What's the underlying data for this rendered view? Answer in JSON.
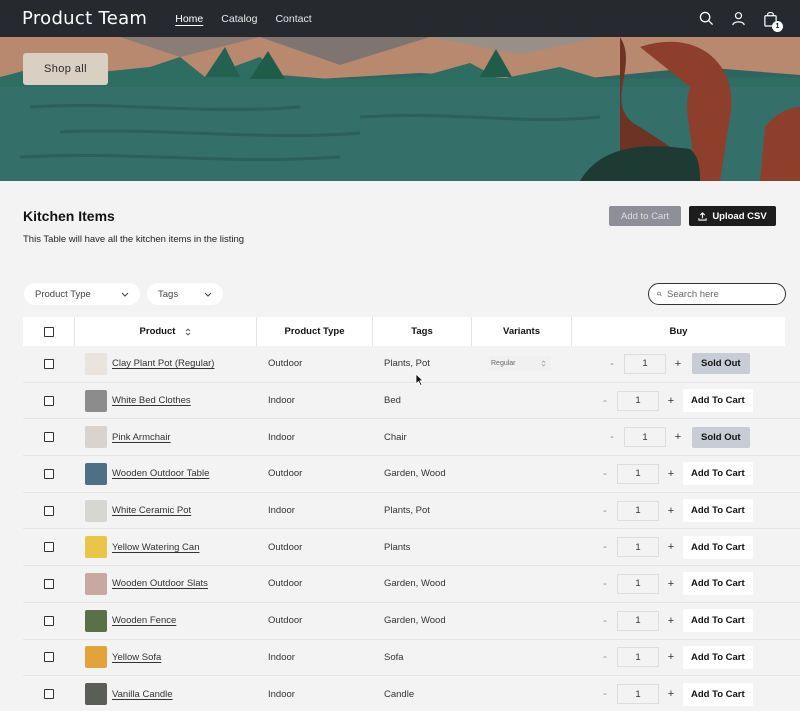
{
  "header": {
    "brand": "Product Team",
    "nav": [
      {
        "label": "Home",
        "active": true
      },
      {
        "label": "Catalog",
        "active": false
      },
      {
        "label": "Contact",
        "active": false
      }
    ],
    "icons": [
      "search-icon",
      "account-icon",
      "bag-icon"
    ],
    "cart_count": "1"
  },
  "hero": {
    "button_label": "Shop all"
  },
  "section": {
    "title": "Kitchen Items",
    "description": "This Table will have all the kitchen items in the listing",
    "add_to_cart_label": "Add to Cart",
    "upload_label": "Upload CSV"
  },
  "filters": {
    "product_type_label": "Product Type",
    "tags_label": "Tags",
    "search_placeholder": "Search here"
  },
  "table": {
    "columns": [
      "Product",
      "Product Type",
      "Tags",
      "Variants",
      "Buy"
    ],
    "rows": [
      {
        "name": "Clay Plant Pot (Regular)",
        "type": "Outdoor",
        "tags": "Plants, Pot",
        "variant": "Regular",
        "qty": "1",
        "action": "Sold Out",
        "sold_out": true,
        "thumb_color": "#e9e4de"
      },
      {
        "name": "White Bed Clothes",
        "type": "Indoor",
        "tags": "Bed",
        "variant": "",
        "qty": "1",
        "action": "Add To Cart",
        "sold_out": false,
        "thumb_color": "#8c8c8c"
      },
      {
        "name": "Pink Armchair",
        "type": "Indoor",
        "tags": "Chair",
        "variant": "",
        "qty": "1",
        "action": "Sold Out",
        "sold_out": true,
        "thumb_color": "#d8d3ce"
      },
      {
        "name": "Wooden Outdoor Table",
        "type": "Outdoor",
        "tags": "Garden, Wood",
        "variant": "",
        "qty": "1",
        "action": "Add To Cart",
        "sold_out": false,
        "thumb_color": "#4f6f86"
      },
      {
        "name": "White Ceramic Pot",
        "type": "Indoor",
        "tags": "Plants, Pot",
        "variant": "",
        "qty": "1",
        "action": "Add To Cart",
        "sold_out": false,
        "thumb_color": "#d6d6d2"
      },
      {
        "name": "Yellow Watering Can",
        "type": "Outdoor",
        "tags": "Plants",
        "variant": "",
        "qty": "1",
        "action": "Add To Cart",
        "sold_out": false,
        "thumb_color": "#e7c64a"
      },
      {
        "name": "Wooden Outdoor Slats",
        "type": "Outdoor",
        "tags": "Garden, Wood",
        "variant": "",
        "qty": "1",
        "action": "Add To Cart",
        "sold_out": false,
        "thumb_color": "#c9a8a1"
      },
      {
        "name": "Wooden Fence",
        "type": "Outdoor",
        "tags": "Garden, Wood",
        "variant": "",
        "qty": "1",
        "action": "Add To Cart",
        "sold_out": false,
        "thumb_color": "#5a7048"
      },
      {
        "name": "Yellow Sofa",
        "type": "Indoor",
        "tags": "Sofa",
        "variant": "",
        "qty": "1",
        "action": "Add To Cart",
        "sold_out": false,
        "thumb_color": "#e2a43a"
      },
      {
        "name": "Vanilla Candle",
        "type": "Indoor",
        "tags": "Candle",
        "variant": "",
        "qty": "1",
        "action": "Add To Cart",
        "sold_out": false,
        "thumb_color": "#5b5e57"
      }
    ]
  }
}
